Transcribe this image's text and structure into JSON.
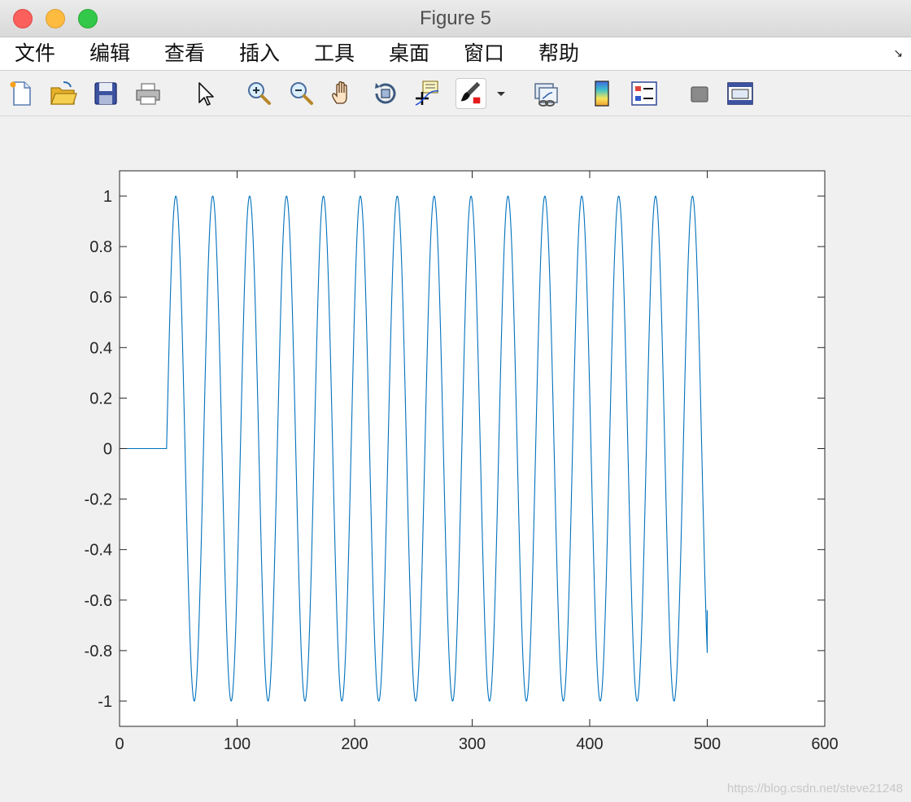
{
  "window": {
    "title": "Figure 5"
  },
  "menubar": {
    "items": [
      "文件",
      "编辑",
      "查看",
      "插入",
      "工具",
      "桌面",
      "窗口",
      "帮助"
    ],
    "overflow_icon": "expand-arrow-icon"
  },
  "toolbar": {
    "tools": [
      "new-figure-icon",
      "open-file-icon",
      "save-icon",
      "print-icon",
      "edit-plot-icon",
      "zoom-in-icon",
      "zoom-out-icon",
      "pan-icon",
      "rotate-3d-icon",
      "data-cursor-icon",
      "brush-icon",
      "brush-dropdown-icon",
      "link-plot-icon",
      "colorbar-icon",
      "legend-icon",
      "hide-plot-tools-icon",
      "show-plot-tools-icon"
    ]
  },
  "chart_data": {
    "type": "line",
    "title": "",
    "xlabel": "",
    "ylabel": "",
    "xlim": [
      0,
      600
    ],
    "ylim": [
      -1.1,
      1.1
    ],
    "xticks": [
      0,
      100,
      200,
      300,
      400,
      500,
      600
    ],
    "yticks": [
      -1,
      -0.8,
      -0.6,
      -0.4,
      -0.2,
      0,
      0.2,
      0.4,
      0.6,
      0.8,
      1
    ],
    "xtick_labels": [
      "0",
      "100",
      "200",
      "300",
      "400",
      "500",
      "600"
    ],
    "ytick_labels": [
      "-1",
      "-0.8",
      "-0.6",
      "-0.4",
      "-0.2",
      "0",
      "0.2",
      "0.4",
      "0.6",
      "0.8",
      "1"
    ],
    "grid": false,
    "line_color": "#0072bd",
    "series": [
      {
        "zero_until_x": 40,
        "signal": "sin",
        "period": 31.4,
        "phase_start_x": 40,
        "amplitude": 1,
        "x_end": 500,
        "end_value": -0.64
      }
    ]
  },
  "watermark": "https://blog.csdn.net/steve21248"
}
